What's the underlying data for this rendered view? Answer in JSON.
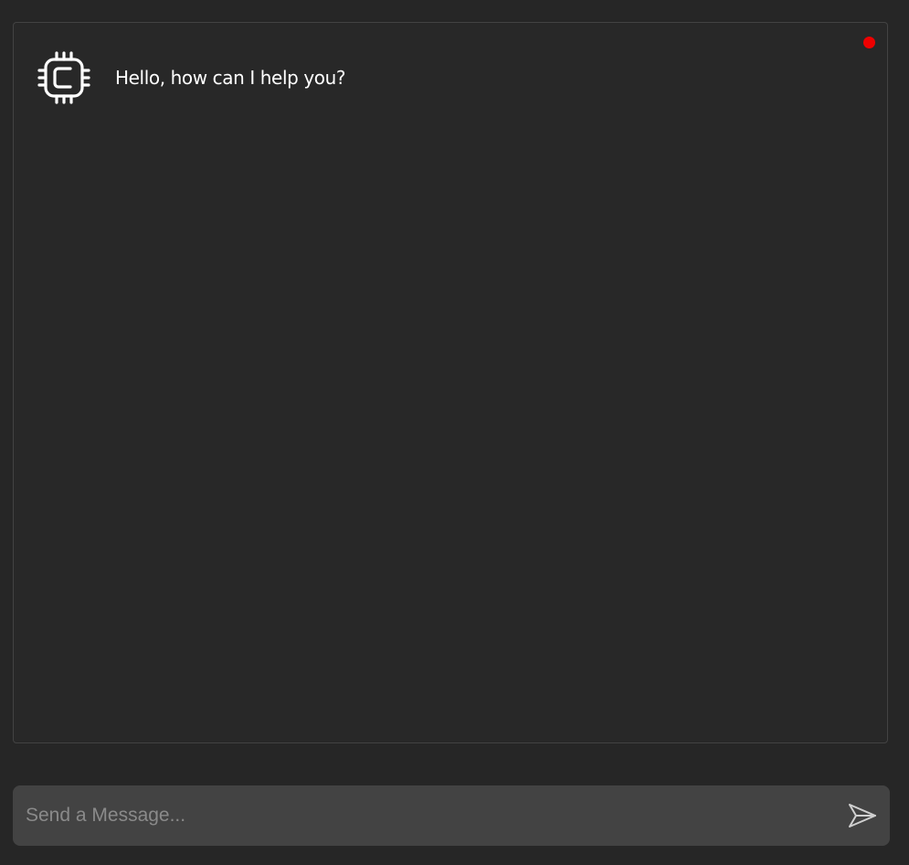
{
  "status": {
    "indicator_color": "#ee0000"
  },
  "conversation": {
    "messages": [
      {
        "sender": "bot",
        "avatar_icon": "cpu-chip-icon",
        "text": "Hello, how can I help you?"
      }
    ]
  },
  "composer": {
    "placeholder": "Send a Message...",
    "value": "",
    "send_icon": "send-arrow-icon"
  },
  "colors": {
    "background": "#262626",
    "panel_border": "#434343",
    "input_background": "#434343",
    "text": "#ffffff"
  }
}
